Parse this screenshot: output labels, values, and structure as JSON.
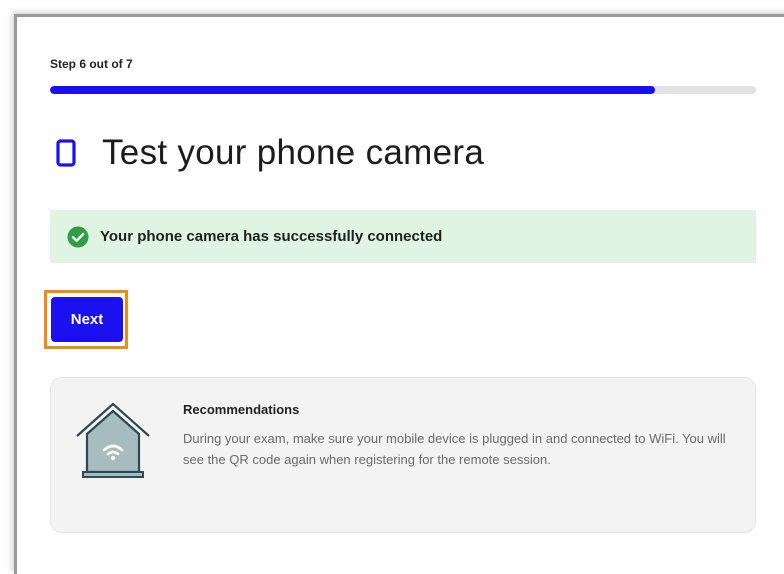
{
  "progress": {
    "step_label": "Step 6 out of 7",
    "current_step": 6,
    "total_steps": 7,
    "fill_fraction": 0.857
  },
  "page": {
    "title": "Test your phone camera",
    "title_icon": "phone-icon"
  },
  "status": {
    "message": "Your phone camera has successfully connected",
    "icon": "check-circle-icon",
    "type": "success"
  },
  "actions": {
    "next_label": "Next"
  },
  "recommendations": {
    "title": "Recommendations",
    "body": "During your exam, make sure your mobile device is plugged in and connected to WiFi. You will see the QR code again when registering for the remote session.",
    "icon": "house-wifi-icon"
  },
  "colors": {
    "accent": "#1a10f0",
    "success_bg": "#dff4e2",
    "success_icon": "#2e9e47",
    "focus_outline": "#f08a15",
    "card_bg": "#f3f3f3",
    "house_fill": "#a7bcbf",
    "house_stroke": "#2b4a52"
  }
}
